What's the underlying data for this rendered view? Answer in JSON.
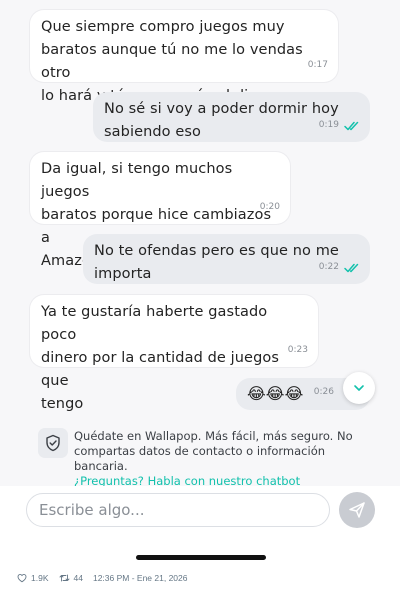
{
  "colors": {
    "accent": "#13c1ac",
    "read_receipt": "#13c1ac",
    "incoming_bubble": "#ffffff",
    "outgoing_bubble": "#e9ebef",
    "chat_background": "#f7f7f9"
  },
  "messages": [
    {
      "direction": "in",
      "text": "Que siempre compro juegos muy\nbaratos aunque tú no me lo vendas otro\nlo hará y tú no ganarás el dinero",
      "time": "0:17"
    },
    {
      "direction": "out",
      "text": "No sé si voy a poder dormir hoy\nsabiendo eso",
      "time": "0:19",
      "read": true
    },
    {
      "direction": "in",
      "text": "Da igual, si tengo muchos juegos\nbaratos porque hice cambiazos a\nAmazon",
      "time": "0:20"
    },
    {
      "direction": "out",
      "text": "No te ofendas pero es que no me\nimporta",
      "time": "0:22",
      "read": true
    },
    {
      "direction": "in",
      "text": "Ya te gustaría haberte gastado poco\ndinero por la cantidad de juegos que\ntengo",
      "time": "0:23"
    },
    {
      "direction": "out",
      "text": "😂😂😂",
      "time": "0:26"
    }
  ],
  "scroll_button": {
    "icon": "chevron-down-icon"
  },
  "safety_notice": {
    "icon": "shield-check-icon",
    "text": "Quédate en Wallapop. Más fácil, más seguro. No compartas datos de contacto o información bancaria.",
    "link": "¿Preguntas? Habla con nuestro chatbot"
  },
  "composer": {
    "placeholder": "Escribe algo...",
    "send_icon": "send-icon"
  },
  "footer": {
    "likes": "1.9K",
    "retweets": "44",
    "timestamp": "12:36 PM - Ene 21, 2026"
  }
}
